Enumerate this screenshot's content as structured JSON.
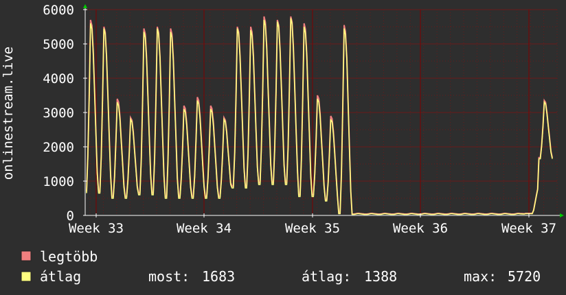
{
  "chart_data": {
    "type": "line",
    "ylabel": "onlinestream.live",
    "ylim": [
      0,
      6000
    ],
    "yticks": [
      0,
      1000,
      2000,
      3000,
      4000,
      5000,
      6000
    ],
    "x_tick_labels": [
      "Week 33",
      "Week 34",
      "Week 35",
      "Week 36",
      "Week 37"
    ],
    "colors": {
      "legtobb": "#f08080",
      "atlag": "#ffff80",
      "grid": "#800000",
      "axis": "#ffffff",
      "arrow": "#00cc00"
    },
    "series": [
      {
        "name": "legtöbb",
        "color": "#f08080",
        "daily_peaks": [
          5700,
          5500,
          3400,
          2850,
          5450,
          5500,
          5450,
          3200,
          3450,
          3200,
          2850,
          5500,
          5500,
          5800,
          5700,
          5800,
          5600,
          3500,
          2900,
          5550,
          60,
          60,
          60,
          60,
          60,
          60,
          60,
          60,
          60,
          60,
          60,
          60,
          60,
          60,
          3350
        ],
        "daily_troughs": [
          700,
          700,
          550,
          550,
          650,
          650,
          550,
          550,
          550,
          550,
          550,
          850,
          850,
          950,
          950,
          950,
          600,
          600,
          450,
          60,
          40,
          40,
          40,
          40,
          40,
          40,
          40,
          40,
          40,
          40,
          40,
          40,
          40,
          60,
          1683
        ],
        "values": [
          5700,
          1683
        ]
      },
      {
        "name": "átlag",
        "color": "#ffff80",
        "daily_peaks": [
          5600,
          5450,
          3300,
          2800,
          5350,
          5450,
          5350,
          3100,
          3350,
          3100,
          2800,
          5450,
          5400,
          5700,
          5650,
          5750,
          5500,
          3400,
          2800,
          5450,
          50,
          50,
          50,
          50,
          50,
          50,
          50,
          50,
          50,
          50,
          50,
          50,
          50,
          50,
          3300
        ],
        "daily_troughs": [
          650,
          650,
          500,
          500,
          600,
          600,
          500,
          500,
          500,
          500,
          500,
          800,
          800,
          900,
          900,
          900,
          550,
          550,
          420,
          50,
          30,
          30,
          30,
          30,
          30,
          30,
          30,
          30,
          30,
          30,
          30,
          30,
          30,
          50,
          1650
        ],
        "values": [
          5600,
          1650
        ]
      }
    ],
    "legend": [
      {
        "label": "legtöbb",
        "color": "#f08080"
      },
      {
        "label": "átlag",
        "color": "#ffff80"
      }
    ],
    "stats": {
      "now_label": "most:",
      "now_value": "1683",
      "avg_label": "átlag:",
      "avg_value": "1388",
      "max_label": "max:",
      "max_value": "5720"
    }
  }
}
